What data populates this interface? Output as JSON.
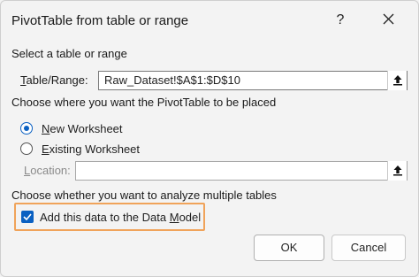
{
  "dialog": {
    "title": "PivotTable from table or range",
    "help": "?",
    "close_icon": "close-icon"
  },
  "select_section": {
    "heading": "Select a table or range",
    "table_range_label_underline": "T",
    "table_range_label_rest": "able/Range:",
    "table_range_value": "Raw_Dataset!$A$1:$D$10",
    "picker_icon": "collapse-range-icon"
  },
  "placement_section": {
    "heading": "Choose where you want the PivotTable to be placed",
    "new_worksheet_underline": "N",
    "new_worksheet_rest": "ew Worksheet",
    "existing_worksheet_underline": "E",
    "existing_worksheet_rest": "xisting Worksheet",
    "selected": "new_worksheet",
    "location_label_underline": "L",
    "location_label_rest": "ocation:",
    "location_value": ""
  },
  "multiple_section": {
    "heading": "Choose whether you want to analyze multiple tables",
    "add_data_model_before": "Add this data to the Data ",
    "add_data_model_underline": "M",
    "add_data_model_after": "odel",
    "add_data_model_checked": true
  },
  "buttons": {
    "ok": "OK",
    "cancel": "Cancel"
  },
  "colors": {
    "accent": "#0a60c2",
    "highlight": "#f0a35a"
  }
}
